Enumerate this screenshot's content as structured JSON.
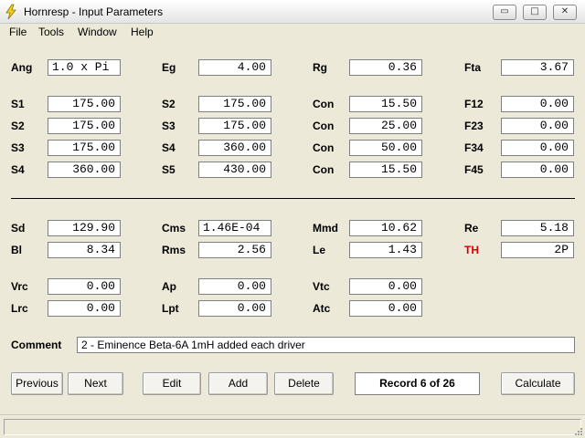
{
  "window": {
    "title": "Hornresp - Input Parameters",
    "controls": {
      "minimize": "▭",
      "maximize": "□",
      "close": "✕"
    }
  },
  "menu": [
    "File",
    "Tools",
    "Window",
    "Help"
  ],
  "labels": {
    "ang": "Ang",
    "eg": "Eg",
    "rg": "Rg",
    "fta": "Fta",
    "s1a": "S1",
    "s2b": "S2",
    "con1": "Con",
    "f12": "F12",
    "s2a": "S2",
    "s3b": "S3",
    "con2": "Con",
    "f23": "F23",
    "s3a": "S3",
    "s4b": "S4",
    "con3": "Con",
    "f34": "F34",
    "s4a": "S4",
    "s5b": "S5",
    "con4": "Con",
    "f45": "F45",
    "sd": "Sd",
    "cms": "Cms",
    "mmd": "Mmd",
    "re": "Re",
    "bl": "Bl",
    "rms": "Rms",
    "le": "Le",
    "th": "TH",
    "vrc": "Vrc",
    "ap": "Ap",
    "vtc": "Vtc",
    "lrc": "Lrc",
    "lpt": "Lpt",
    "atc": "Atc",
    "comment": "Comment"
  },
  "values": {
    "ang": "1.0 x Pi",
    "eg": "4.00",
    "rg": "0.36",
    "fta": "3.67",
    "s1a": "175.00",
    "s2b": "175.00",
    "con1": "15.50",
    "f12": "0.00",
    "s2a": "175.00",
    "s3b": "175.00",
    "con2": "25.00",
    "f23": "0.00",
    "s3a": "175.00",
    "s4b": "360.00",
    "con3": "50.00",
    "f34": "0.00",
    "s4a": "360.00",
    "s5b": "430.00",
    "con4": "15.50",
    "f45": "0.00",
    "sd": "129.90",
    "cms": "1.46E-04",
    "mmd": "10.62",
    "re": "5.18",
    "bl": "8.34",
    "rms": "2.56",
    "le": "1.43",
    "th": "2P",
    "vrc": "0.00",
    "ap": "0.00",
    "vtc": "0.00",
    "lrc": "0.00",
    "lpt": "0.00",
    "atc": "0.00",
    "comment": "2 - Eminence Beta-6A 1mH added each driver"
  },
  "buttons": {
    "previous": "Previous",
    "next": "Next",
    "edit": "Edit",
    "add": "Add",
    "delete": "Delete",
    "calculate": "Calculate"
  },
  "record": "Record 6 of 26",
  "colors": {
    "th_label": "#d40000",
    "background": "#ece9d8"
  }
}
